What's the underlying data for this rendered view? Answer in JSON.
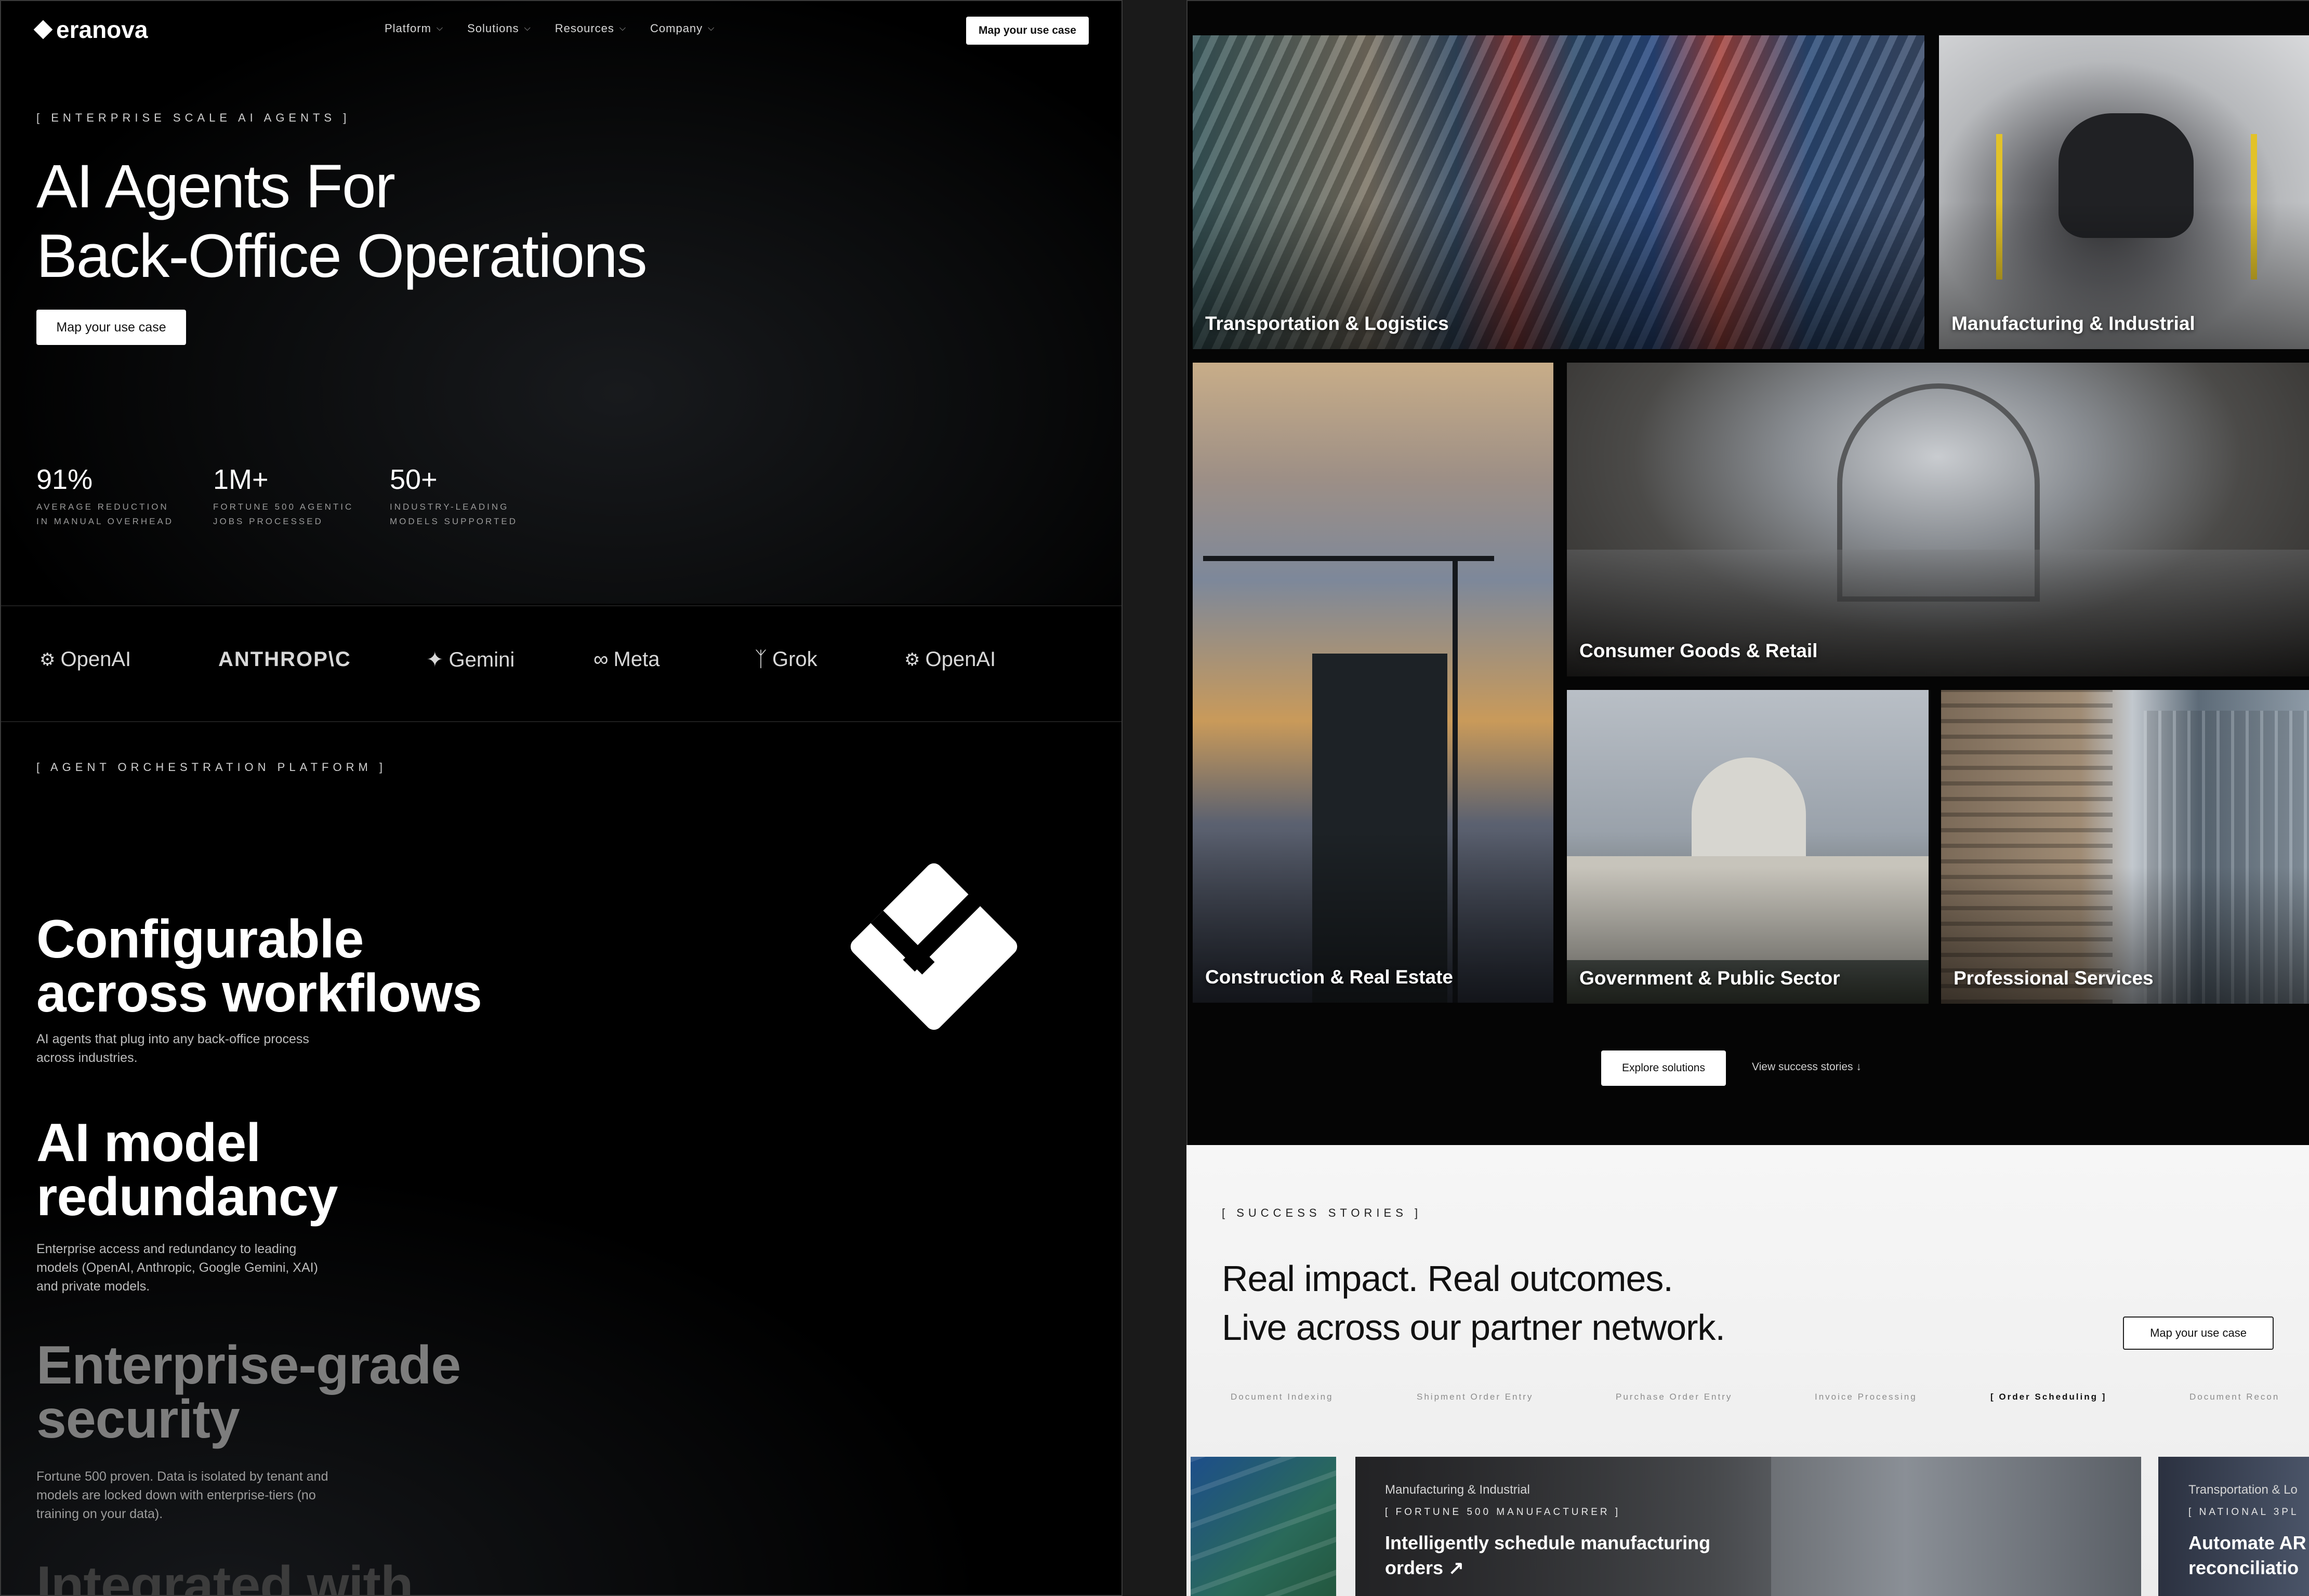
{
  "nav": {
    "brand": "eranova",
    "items": [
      {
        "label": "Platform"
      },
      {
        "label": "Solutions"
      },
      {
        "label": "Resources"
      },
      {
        "label": "Company"
      }
    ],
    "cta": "Map your use case"
  },
  "hero": {
    "tag": "[ ENTERPRISE SCALE AI AGENTS ]",
    "title_line1": "AI Agents For",
    "title_line2": "Back-Office Operations",
    "cta": "Map your use case",
    "stats": [
      {
        "value": "91%",
        "label_line1": "AVERAGE REDUCTION",
        "label_line2": "IN MANUAL OVERHEAD"
      },
      {
        "value": "1M+",
        "label_line1": "FORTUNE 500 AGENTIC",
        "label_line2": "JOBS PROCESSED"
      },
      {
        "value": "50+",
        "label_line1": "INDUSTRY-LEADING",
        "label_line2": "MODELS SUPPORTED"
      }
    ]
  },
  "logos": [
    "OpenAI",
    "ANTHROP\\C",
    "Gemini",
    "Meta",
    "Grok",
    "OpenAI"
  ],
  "platform": {
    "tag": "[ AGENT ORCHESTRATION PLATFORM ]",
    "features": [
      {
        "title_line1": "Configurable",
        "title_line2": "across workflows",
        "desc_line1": "AI agents that plug into any back-office process",
        "desc_line2": "across industries.",
        "desc_line3": ""
      },
      {
        "title_line1": "AI model",
        "title_line2": "redundancy",
        "desc_line1": "Enterprise access and redundancy to leading",
        "desc_line2": "models (OpenAI, Anthropic, Google Gemini, XAI)",
        "desc_line3": "and private models."
      },
      {
        "title_line1": "Enterprise-grade",
        "title_line2": "security",
        "desc_line1": "Fortune 500 proven. Data is isolated by tenant and",
        "desc_line2": "models are locked down with enterprise-tiers (no",
        "desc_line3": "training on your data)."
      },
      {
        "title_line1": "Integrated with",
        "title_line2": "",
        "desc_line1": "",
        "desc_line2": "",
        "desc_line3": ""
      }
    ]
  },
  "industries": [
    {
      "label": "Transportation & Logistics"
    },
    {
      "label": "Manufacturing & Industrial"
    },
    {
      "label": "Construction & Real Estate"
    },
    {
      "label": "Consumer Goods & Retail"
    },
    {
      "label": "Government & Public Sector"
    },
    {
      "label": "Professional Services"
    }
  ],
  "industry_actions": {
    "explore": "Explore solutions",
    "stories": "View success stories ↓"
  },
  "stories": {
    "tag": "[ SUCCESS STORIES ]",
    "title_line1": "Real impact. Real outcomes.",
    "title_line2": "Live across our partner network.",
    "cta": "Map your use case",
    "tabs": [
      "Document Indexing",
      "Shipment Order Entry",
      "Purchase Order Entry",
      "Invoice Processing",
      "[ Order Scheduling ]",
      "Document Recon"
    ],
    "active_tab_index": 4,
    "cards": [
      {
        "industry": "Manufacturing & Industrial",
        "client": "[ FORTUNE 500 MANUFACTURER ]",
        "title_line1": "Intelligently schedule manufacturing",
        "title_line2": "orders ↗"
      },
      {
        "industry": "Transportation & Lo",
        "client": "[ NATIONAL 3PL",
        "title_line1": "Automate AR",
        "title_line2": "reconciliatio"
      }
    ]
  },
  "colors": {
    "bg_dark": "#000000",
    "text_light": "#ffffff",
    "muted": "#9a9a9a",
    "light_section": "#f2f2f2"
  }
}
